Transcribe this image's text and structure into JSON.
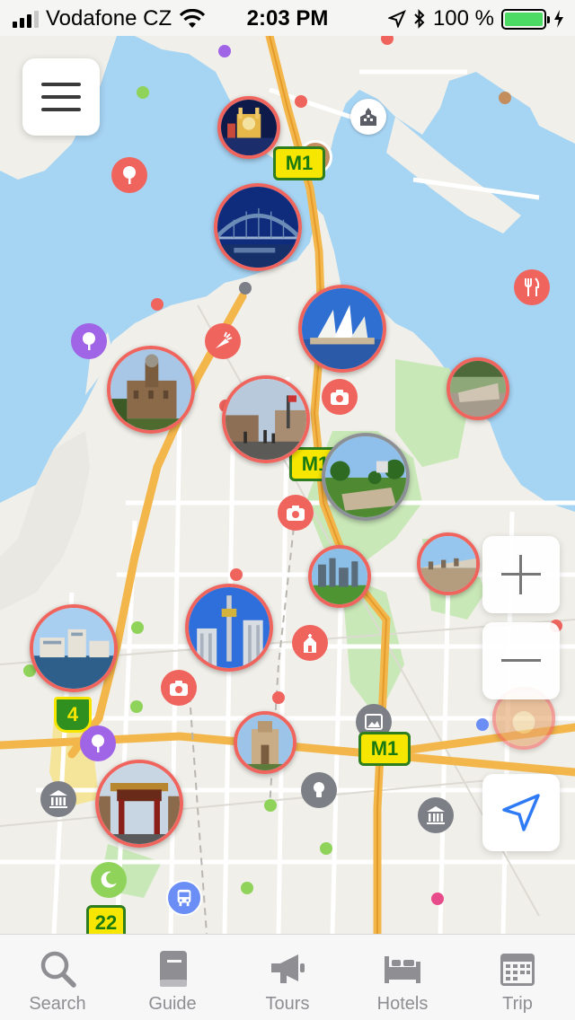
{
  "status_bar": {
    "carrier": "Vodafone CZ",
    "time": "2:03 PM",
    "battery": "100 %"
  },
  "map": {
    "road_shields": [
      "M1",
      "M1",
      "M1",
      "4",
      "22"
    ],
    "colors": {
      "water": "#a6d4f3",
      "land": "#f0efe9",
      "park": "#c9e8b8",
      "highway": "#f3b64a",
      "pin_red": "#f0645e"
    }
  },
  "tabs": [
    {
      "label": "Search",
      "icon": "search-icon"
    },
    {
      "label": "Guide",
      "icon": "book-icon"
    },
    {
      "label": "Tours",
      "icon": "megaphone-icon"
    },
    {
      "label": "Hotels",
      "icon": "bed-icon"
    },
    {
      "label": "Trip",
      "icon": "calendar-icon"
    }
  ]
}
